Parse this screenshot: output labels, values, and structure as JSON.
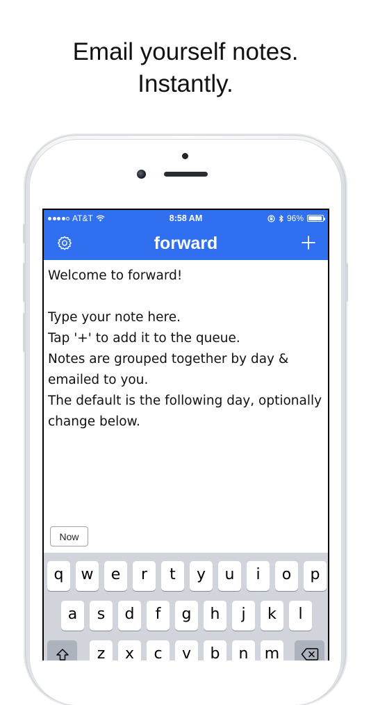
{
  "headline": {
    "line1": "Email yourself notes.",
    "line2": "Instantly."
  },
  "status_bar": {
    "carrier": "AT&T",
    "time": "8:58 AM",
    "battery": "96%"
  },
  "nav": {
    "title": "forward",
    "left_icon": "gear-icon",
    "right_icon": "plus-icon"
  },
  "note": {
    "text": "Welcome to forward!\n\nType your note here.\nTap '+' to add it to the queue.\nNotes are grouped together by day & emailed to you.\nThe default is the following day, optionally change below."
  },
  "toolbar": {
    "now_label": "Now"
  },
  "keyboard": {
    "row1": [
      "q",
      "w",
      "e",
      "r",
      "t",
      "y",
      "u",
      "i",
      "o",
      "p"
    ],
    "row2": [
      "a",
      "s",
      "d",
      "f",
      "g",
      "h",
      "j",
      "k",
      "l"
    ],
    "row3": [
      "z",
      "x",
      "c",
      "v",
      "b",
      "n",
      "m"
    ],
    "shift_icon": "shift-icon",
    "delete_icon": "backspace-icon"
  },
  "colors": {
    "accent": "#2f6ff0",
    "keyboard_bg": "#d1d4db"
  }
}
